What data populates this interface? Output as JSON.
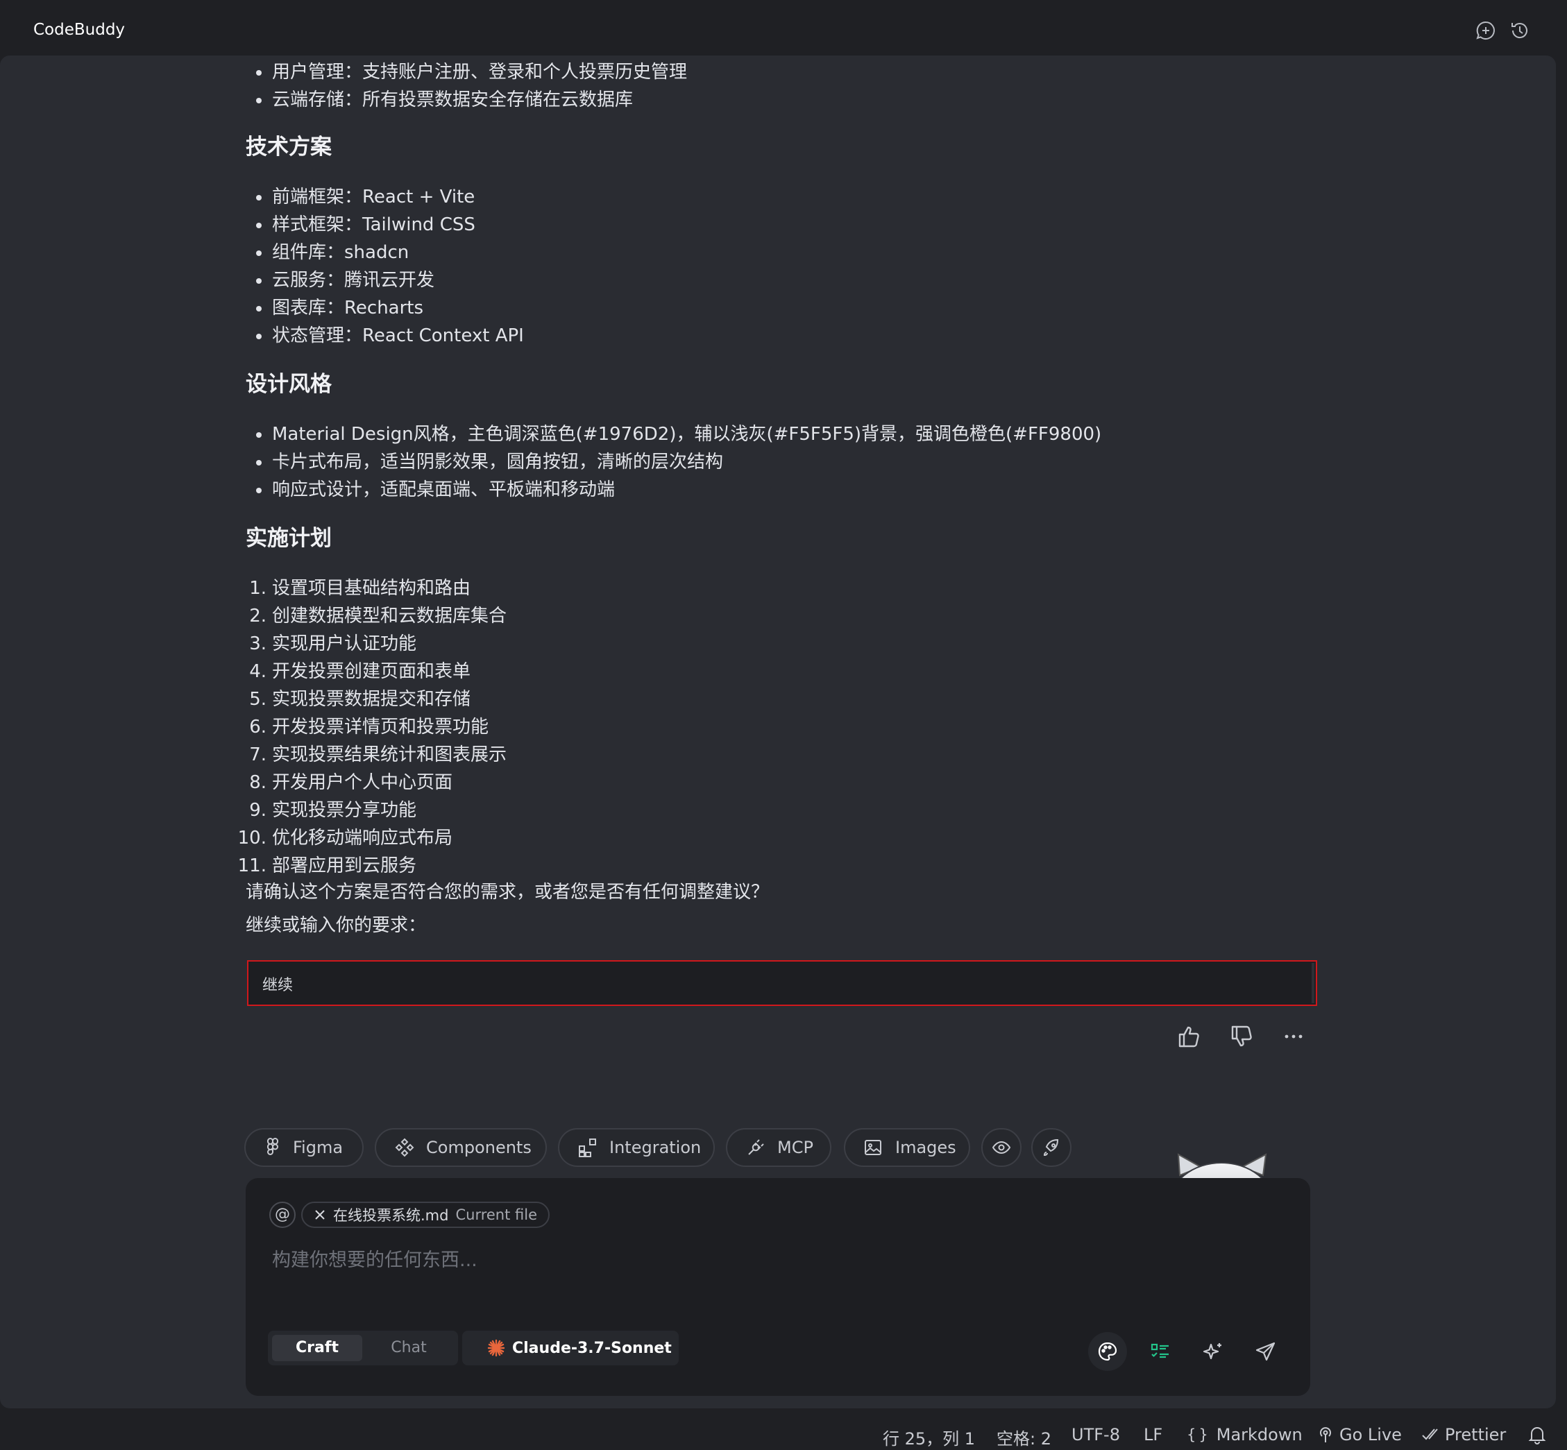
{
  "app": {
    "title": "CodeBuddy",
    "new_chat_icon": "chat-plus-icon",
    "history_icon": "history-icon"
  },
  "message": {
    "top_bullets": [
      "用户管理：支持账户注册、登录和个人投票历史管理",
      "云端存储：所有投票数据安全存储在云数据库"
    ],
    "tech_heading": "技术方案",
    "tech_bullets": [
      "前端框架：React + Vite",
      "样式框架：Tailwind CSS",
      "组件库：shadcn",
      "云服务：腾讯云开发",
      "图表库：Recharts",
      "状态管理：React Context API"
    ],
    "design_heading": "设计风格",
    "design_bullets": [
      "Material Design风格，主色调深蓝色(#1976D2)，辅以浅灰(#F5F5F5)背景，强调色橙色(#FF9800)",
      "卡片式布局，适当阴影效果，圆角按钮，清晰的层次结构",
      "响应式设计，适配桌面端、平板端和移动端"
    ],
    "plan_heading": "实施计划",
    "plan_numbers": [
      "1.",
      "2.",
      "3.",
      "4.",
      "5.",
      "6.",
      "7.",
      "8.",
      "9.",
      "10.",
      "11."
    ],
    "plan_steps": [
      "设置项目基础结构和路由",
      "创建数据模型和云数据库集合",
      "实现用户认证功能",
      "开发投票创建页面和表单",
      "实现投票数据提交和存储",
      "开发投票详情页和投票功能",
      "实现投票结果统计和图表展示",
      "开发用户个人中心页面",
      "实现投票分享功能",
      "优化移动端响应式布局",
      "部署应用到云服务"
    ],
    "confirm_question": "请确认这个方案是否符合您的需求，或者您是否有任何调整建议？",
    "continue_prompt": "继续或输入你的要求：",
    "reply_value": "继续"
  },
  "feedback": {
    "like_icon": "thumbs-up-icon",
    "dislike_icon": "thumbs-down-icon",
    "more_icon": "more-horizontal-icon"
  },
  "toolbar": {
    "figma": "Figma",
    "components": "Components",
    "integration": "Integration",
    "mcp": "MCP",
    "images": "Images",
    "preview_icon": "eye-icon",
    "deploy_icon": "rocket-icon"
  },
  "composer": {
    "at_label": "@",
    "file_name": "在线投票系统.md",
    "file_sub": "Current file",
    "placeholder": "构建你想要的任何东西...",
    "mode_craft": "Craft",
    "mode_chat": "Chat",
    "model": "Claude-3.7-Sonnet",
    "accent_color": "#e8663c",
    "todo_icon_color": "#23c48a"
  },
  "status": {
    "position": "行 25，列 1",
    "spaces": "空格: 2",
    "encoding": "UTF-8",
    "eol": "LF",
    "language": "Markdown",
    "go_live": "Go Live",
    "prettier": "Prettier"
  }
}
